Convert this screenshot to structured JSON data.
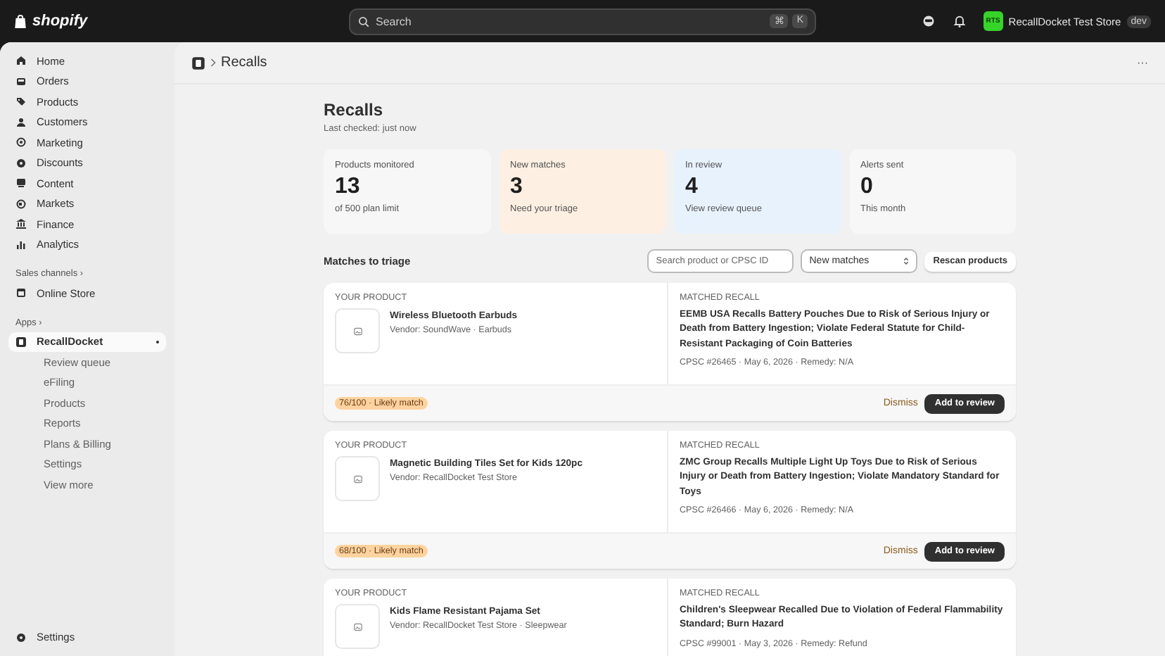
{
  "topbar": {
    "logo": "shopify",
    "search": {
      "placeholder": "Search",
      "keys": [
        "⌘",
        "K"
      ]
    },
    "store": {
      "avatar": "RTS",
      "name": "RecallDocket Test Store",
      "badge": "dev"
    }
  },
  "sidebar": {
    "items": [
      {
        "label": "Home",
        "selected": false
      },
      {
        "label": "Orders",
        "selected": false
      },
      {
        "label": "Products",
        "selected": false
      },
      {
        "label": "Customers",
        "selected": false
      },
      {
        "label": "Marketing",
        "selected": false
      },
      {
        "label": "Discounts",
        "selected": false
      },
      {
        "label": "Content",
        "selected": false
      },
      {
        "label": "Markets",
        "selected": false
      },
      {
        "label": "Finance",
        "selected": false
      },
      {
        "label": "Analytics",
        "selected": false
      }
    ],
    "sections": [
      {
        "title": "Sales channels ›",
        "items": [
          {
            "label": "Online Store",
            "selected": false
          }
        ]
      },
      {
        "title": "Apps ›",
        "items": [
          {
            "label": "RecallDocket",
            "selected": true,
            "children": [
              {
                "label": "Review queue",
                "selected": false
              },
              {
                "label": "eFiling",
                "selected": false
              },
              {
                "label": "Products",
                "selected": false
              },
              {
                "label": "Reports",
                "selected": false
              },
              {
                "label": "Plans & Billing",
                "selected": false
              },
              {
                "label": "Settings",
                "selected": false
              },
              {
                "label": "View more",
                "selected": false
              }
            ]
          }
        ]
      }
    ],
    "footer": {
      "label": "Settings"
    }
  },
  "header": {
    "breadcrumb": "Recalls",
    "more": "···"
  },
  "page": {
    "title": "Recalls",
    "subtitle": "Last checked: just now",
    "stats": [
      {
        "label": "Products monitored",
        "value": "13",
        "note": "of 500 plan limit",
        "kind": "plain"
      },
      {
        "label": "New matches",
        "value": "3",
        "note": "Need your triage",
        "kind": "warning"
      },
      {
        "label": "In review",
        "value": "4",
        "note": "View review queue",
        "kind": "info"
      },
      {
        "label": "Alerts sent",
        "value": "0",
        "note": "This month",
        "kind": "plain"
      }
    ],
    "section": {
      "title": "Matches to triage",
      "search_placeholder": "Search product or CPSC ID",
      "filter": "New matches",
      "button": "Rescan products"
    },
    "matches": [
      {
        "product_label": "YOUR PRODUCT",
        "product": "Wireless Bluetooth Earbuds",
        "vendor": "Vendor: SoundWave · Earbuds",
        "recall_label": "MATCHED RECALL",
        "recall": "EEMB USA Recalls Battery Pouches Due to Risk of Serious Injury or Death from Battery Ingestion; Violate Federal Statute for Child-Resistant Packaging of Coin Batteries",
        "meta": "CPSC #26465 · May 6, 2026 · Remedy: N/A",
        "score": "76/100 · Likely match",
        "dismiss": "Dismiss",
        "add": "Add to review"
      },
      {
        "product_label": "YOUR PRODUCT",
        "product": "Magnetic Building Tiles Set for Kids 120pc",
        "vendor": "Vendor: RecallDocket Test Store",
        "recall_label": "MATCHED RECALL",
        "recall": "ZMC Group Recalls Multiple Light Up Toys Due to Risk of Serious Injury or Death from Battery Ingestion; Violate Mandatory Standard for Toys",
        "meta": "CPSC #26466 · May 6, 2026 · Remedy: N/A",
        "score": "68/100 · Likely match",
        "dismiss": "Dismiss",
        "add": "Add to review"
      },
      {
        "product_label": "YOUR PRODUCT",
        "product": "Kids Flame Resistant Pajama Set",
        "vendor": "Vendor: RecallDocket Test Store · Sleepwear",
        "recall_label": "MATCHED RECALL",
        "recall": "Children's Sleepwear Recalled Due to Violation of Federal Flammability Standard; Burn Hazard",
        "meta": "CPSC #99001 · May 3, 2026 · Remedy: Refund"
      }
    ]
  }
}
